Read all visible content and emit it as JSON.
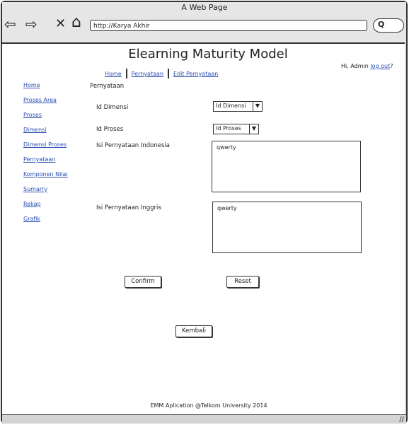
{
  "window": {
    "title": "A Web Page",
    "url": "http://Karya Akhir"
  },
  "header": {
    "title": "Elearning Maturity Model",
    "greeting": "Hi, Admin",
    "logout_label": "log out",
    "logout_suffix": "?"
  },
  "breadcrumb": {
    "items": [
      "Home",
      "Pernyataan",
      "Edit Pernyataan"
    ]
  },
  "current_page": "Pernyataan",
  "sidebar": {
    "items": [
      "Home",
      "Proses Area",
      "Proses",
      "Dimensi",
      "Dimensi Proses",
      "Pernyataan",
      "Komponen Nilai",
      "Sumarry",
      "Rekap",
      "Grafik"
    ]
  },
  "form": {
    "id_dimensi": {
      "label": "Id Dimensi",
      "value": "Id Dimensi"
    },
    "id_proses": {
      "label": "Id Proses",
      "value": "Id Proses"
    },
    "isi_indonesia": {
      "label": "Isi Pernyataan Indonesia",
      "value": "qwerty"
    },
    "isi_inggris": {
      "label": "Isi Pernyataan Inggris",
      "value": "qwerty"
    }
  },
  "buttons": {
    "confirm": "Confirm",
    "reset": "Reset",
    "kembali": "Kembali"
  },
  "footer": "EMM Aplication @Telkom University 2014"
}
